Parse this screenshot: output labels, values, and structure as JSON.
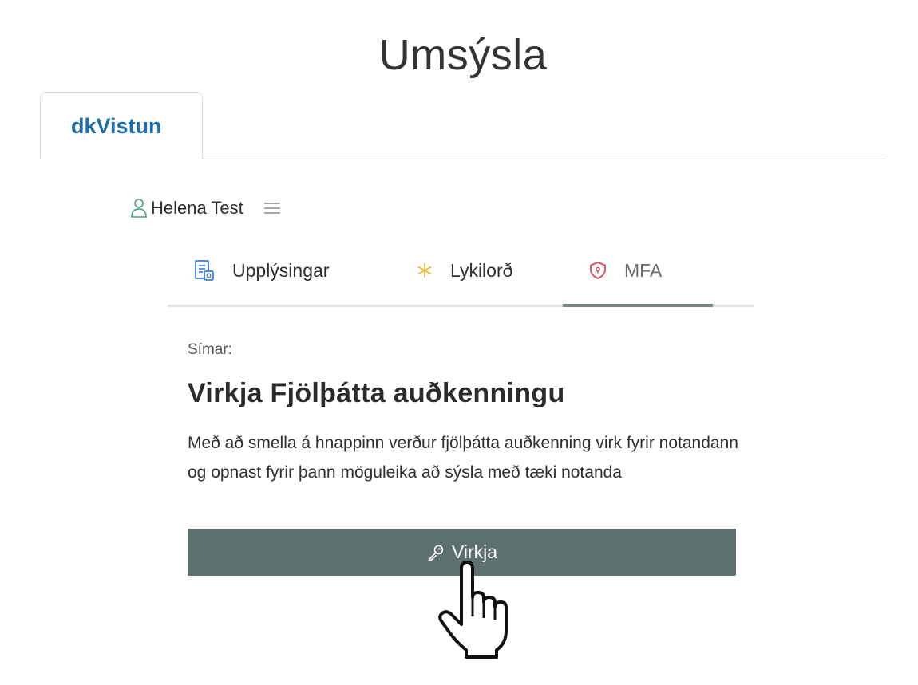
{
  "page": {
    "title": "Umsýsla"
  },
  "outer_tabs": [
    {
      "label": "dkVistun",
      "active": true
    }
  ],
  "user": {
    "name": "Helena Test",
    "icon": "user-icon",
    "menu_icon": "hamburger-menu-icon"
  },
  "inner_tabs": [
    {
      "label": "Upplýsingar",
      "icon": "info-document-icon",
      "icon_color": "#3d7bd9",
      "active": false
    },
    {
      "label": "Lykilorð",
      "icon": "asterisk-icon",
      "icon_color": "#f0b429",
      "active": false
    },
    {
      "label": "MFA",
      "icon": "shield-icon",
      "icon_color": "#e0435a",
      "active": true
    }
  ],
  "mfa": {
    "section_label": "Símar:",
    "heading": "Virkja Fjölþátta auðkenningu",
    "description": "Með að smella á hnappinn verður fjölþátta auðkenning virk fyrir notandann og opnast fyrir þann möguleika að sýsla með tæki notanda",
    "button": {
      "label": "Virkja",
      "icon": "key-icon"
    }
  },
  "colors": {
    "accent_link": "#1e6fa8",
    "button_bg": "#5c706f",
    "active_tab_bar": "#7a8584"
  },
  "cursor": {
    "type": "hand-pointer-icon"
  }
}
